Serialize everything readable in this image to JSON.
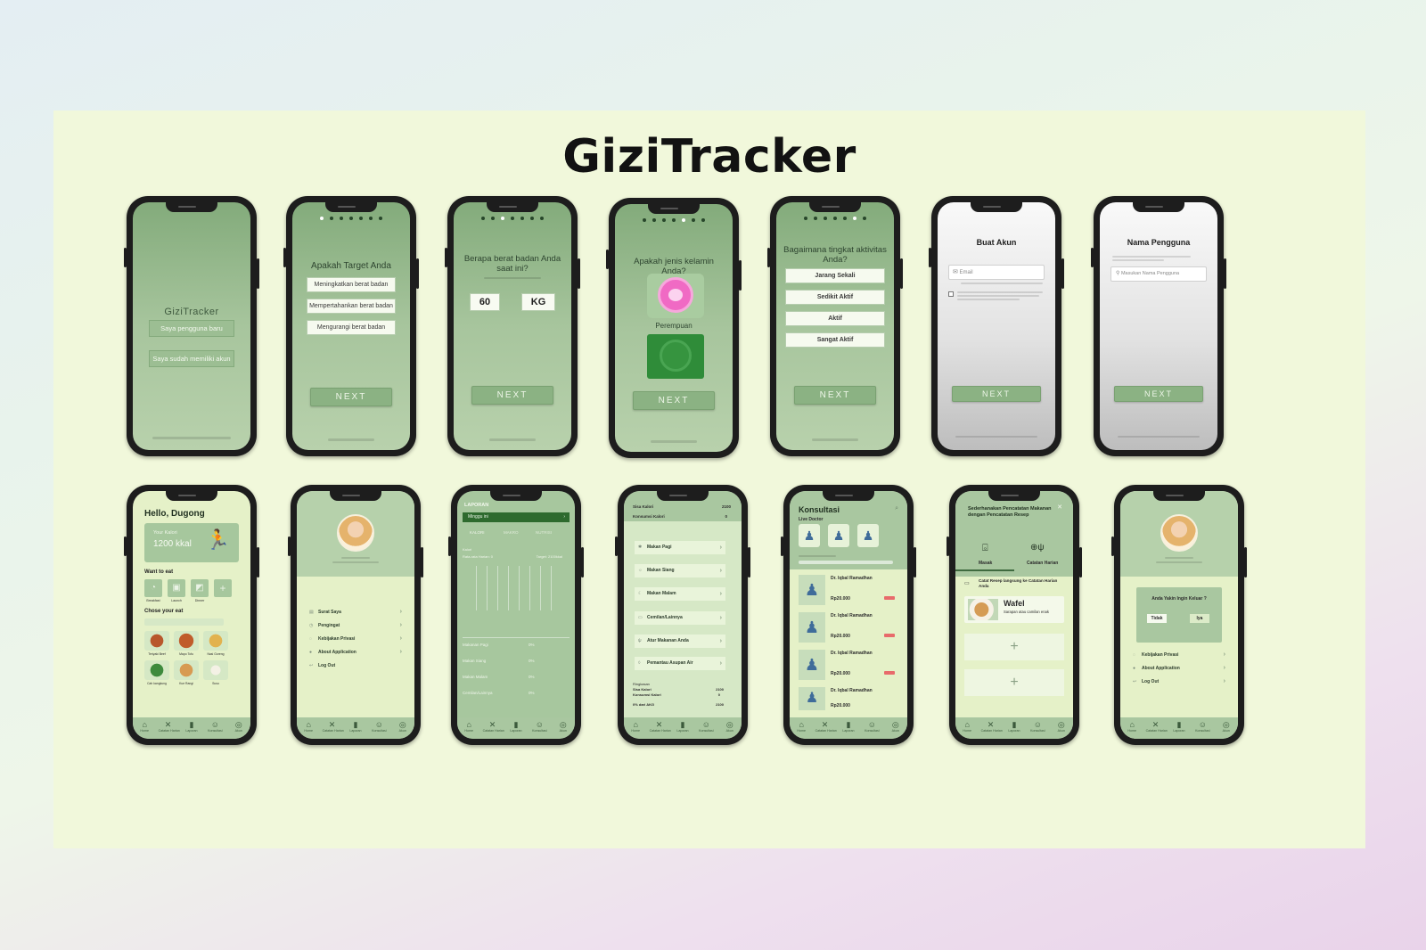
{
  "title": "GiziTracker",
  "colors": {
    "board": "#f1f8db",
    "accent_green": "#8bb283",
    "dark_green": "#2e6a2e",
    "pink": "#f06ac4"
  },
  "s1": {
    "logo": "GiziTracker",
    "btn_new": "Saya pengguna baru",
    "btn_existing": "Saya sudah memiliki akun"
  },
  "s2": {
    "question": "Apakah Target Anda",
    "options": [
      "Meningkatkan berat badan",
      "Mempertahankan berat badan",
      "Mengurangi berat badan"
    ],
    "next": "NEXT"
  },
  "s3": {
    "question": "Berapa berat badan Anda saat ini?",
    "weight": "60",
    "unit": "KG",
    "next": "NEXT"
  },
  "s4": {
    "question": "Apakah jenis kelamin Anda?",
    "female_label": "Perempuan",
    "next": "NEXT"
  },
  "s5": {
    "question": "Bagaimana tingkat aktivitas Anda?",
    "options": [
      "Jarang Sekali",
      "Sedikit Aktif",
      "Aktif",
      "Sangat Aktif"
    ],
    "next": "NEXT"
  },
  "s6": {
    "title": "Buat Akun",
    "email_placeholder": "Email",
    "next": "NEXT"
  },
  "s7": {
    "title": "Nama Pengguna",
    "name_placeholder": "Masukan Nama Pengguna",
    "next": "NEXT"
  },
  "s8": {
    "greeting": "Hello, Dugong",
    "kalori_label": "Your Kalori",
    "kalori_value": "1200 kkal",
    "want_to_eat": "Want to eat",
    "meals": [
      "Breakfast",
      "Launch",
      "Dinner"
    ],
    "chose": "Chose your eat",
    "foods": [
      "Teriyaki Beef",
      "Mapo Tofu",
      "Nasi Goreng",
      "Cah kangkung",
      "Kue Rangi",
      "Susu"
    ]
  },
  "nav": [
    "Home",
    "Catatan Harian",
    "Laporan",
    "Konsultasi",
    "Akun"
  ],
  "s9": {
    "menu": [
      "Surat Saya",
      "Pengingat",
      "Kebijakan Privasi",
      "About Application",
      "Log Out"
    ]
  },
  "s10": {
    "header": "LAPORAN",
    "period": "Minggu ini",
    "tabs": [
      "KALORI",
      "MAKRO",
      "NUTRISI"
    ],
    "kalori": "Kalori",
    "avg": "Rata-rata Harian: 0",
    "target": "Target: 2100kkal",
    "rows": [
      "Makanan Pagi",
      "Makan Siang",
      "Makan Malam",
      "Cemilan/Lainnya"
    ],
    "pct": [
      "0%",
      "0%",
      "0%",
      "0%"
    ]
  },
  "s11": {
    "sisa_label": "Sisa Kalori",
    "sisa_value": "2100",
    "konsumsi_label": "Konsumsi Kalori",
    "konsumsi_value": "0",
    "items": [
      "Makan Pagi",
      "Makan Siang",
      "Makan Malam",
      "Cemilan/Lainnya",
      "Atur Makanan Anda",
      "Pemantau Asupan Air"
    ],
    "ringkasan": "Ringkasan",
    "sum_sisa": "Sisa Kalori",
    "sum_sisa_val": "2100",
    "sum_kons": "Konsumsi Kalori",
    "sum_kons_val": "0",
    "akg": "0% dari AKG",
    "akg_val": "2100"
  },
  "s12": {
    "title": "Konsultasi",
    "live": "Live Doctor",
    "doctors": [
      {
        "name": "Dr. Iqbal Ramadhan",
        "price": "Rp20.000"
      },
      {
        "name": "Dr. Iqbal Ramadhan",
        "price": "Rp20.000"
      },
      {
        "name": "Dr. Iqbal Ramadhan",
        "price": "Rp20.000"
      },
      {
        "name": "Dr. Iqbal Ramadhan",
        "price": "Rp20.000"
      }
    ]
  },
  "s13": {
    "title": "Sederhanakan Pencatatan Makanan dengan Pencatatan Resep",
    "tab_masak": "Masak",
    "tab_catatan": "Catatan Harian",
    "record": "Catat Resep langsung ke Catatan Harian Anda",
    "item_name": "Wafel",
    "item_desc": "Sarapan atau camilan enak"
  },
  "s14": {
    "dialog_title": "Anda Yakin Ingin Keluar ?",
    "no": "Tidak",
    "yes": "Iya",
    "menu": [
      "Kebijakan Privasi",
      "About Application",
      "Log Out"
    ]
  }
}
